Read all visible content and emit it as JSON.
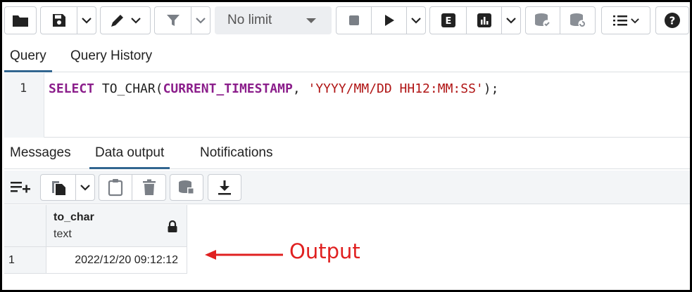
{
  "toolbar": {
    "limit_label": "No limit",
    "buttons": [
      {
        "icon": "folder-icon"
      },
      {
        "icon": "save-icon"
      },
      {
        "icon": "chevron-down-icon"
      },
      {
        "icon": "edit-pencil-icon"
      },
      {
        "icon": "filter-icon"
      },
      {
        "icon": "stop-icon"
      },
      {
        "icon": "play-icon"
      },
      {
        "icon": "explain-icon",
        "text": "E"
      },
      {
        "icon": "explain-analyze-icon"
      },
      {
        "icon": "commit-icon"
      },
      {
        "icon": "rollback-icon"
      },
      {
        "icon": "macros-icon"
      },
      {
        "icon": "help-icon",
        "text": "?"
      }
    ]
  },
  "query_tabs": [
    {
      "label": "Query",
      "active": true
    },
    {
      "label": "Query History",
      "active": false
    }
  ],
  "editor": {
    "line_number": "1",
    "tokens": {
      "t1": "SELECT",
      "t2": " TO_CHAR(",
      "t3": "CURRENT_TIMESTAMP",
      "t4": ", ",
      "t5": "'YYYY/MM/DD HH12:MM:SS'",
      "t6": ");"
    }
  },
  "output_tabs": [
    {
      "label": "Messages",
      "active": false
    },
    {
      "label": "Data output",
      "active": true
    },
    {
      "label": "Notifications",
      "active": false
    }
  ],
  "grid": {
    "columns": [
      {
        "name": "to_char",
        "type": "text"
      }
    ],
    "rows": [
      {
        "row_number": "1",
        "values": [
          "2022/12/20 09:12:12"
        ]
      }
    ]
  },
  "annotation": {
    "label": "Output",
    "color": "#e02020"
  },
  "colors": {
    "keyword": "#8b1e8b",
    "string": "#b01515",
    "tab_active": "#326690"
  }
}
